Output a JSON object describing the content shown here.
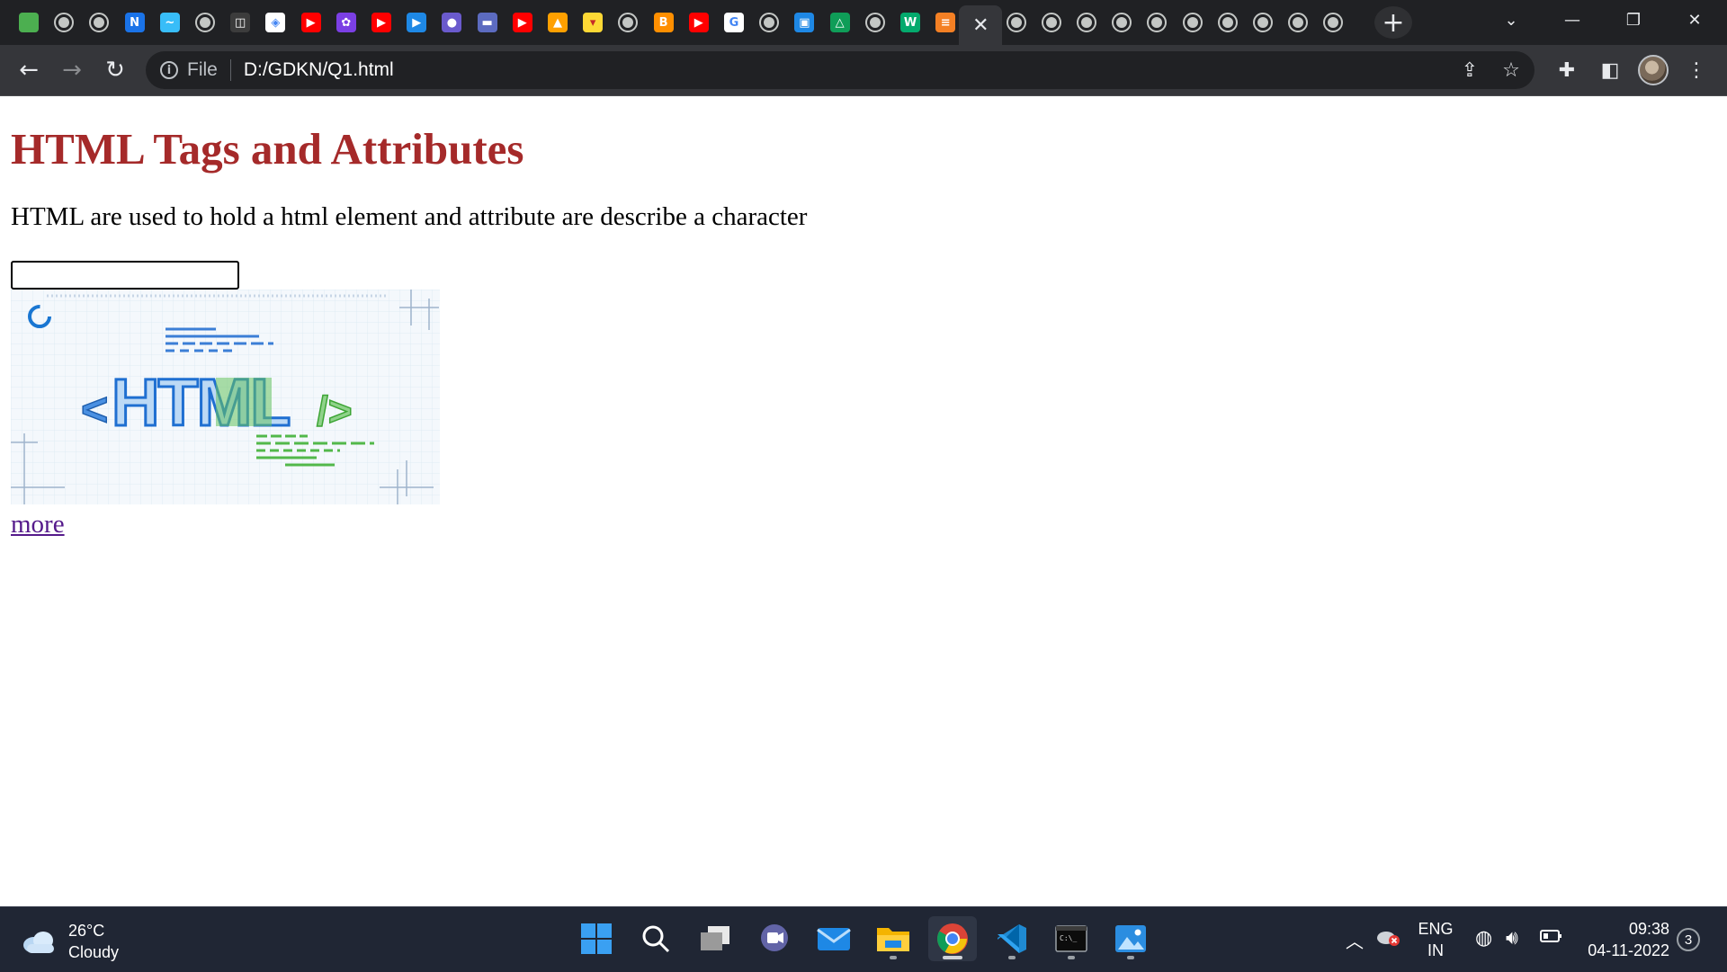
{
  "browser": {
    "url_scheme_label": "File",
    "url": "D:/GDKN/Q1.html",
    "tabs": [
      {
        "icon": "green-hexagon-favicon",
        "color": "#4caf50",
        "glyph": ""
      },
      {
        "icon": "globe-favicon",
        "color": "",
        "glyph": ""
      },
      {
        "icon": "globe-favicon",
        "color": "",
        "glyph": ""
      },
      {
        "icon": "notion-favicon",
        "color": "#1a73e8",
        "glyph": "N"
      },
      {
        "icon": "tailwind-favicon",
        "color": "#38bdf8",
        "glyph": "~"
      },
      {
        "icon": "globe-favicon",
        "color": "",
        "glyph": ""
      },
      {
        "icon": "book-favicon",
        "color": "#3c3c3c",
        "glyph": "◫"
      },
      {
        "icon": "diamond-favicon",
        "color": "#ffffff",
        "glyph": "◈"
      },
      {
        "icon": "youtube-favicon",
        "color": "#ff0000",
        "glyph": "▶"
      },
      {
        "icon": "graphql-favicon",
        "color": "#7b3fe4",
        "glyph": "✿"
      },
      {
        "icon": "youtube-favicon",
        "color": "#ff0000",
        "glyph": "▶"
      },
      {
        "icon": "play-favicon",
        "color": "#1e88e5",
        "glyph": "▶"
      },
      {
        "icon": "orb-favicon",
        "color": "#6a5acd",
        "glyph": "●"
      },
      {
        "icon": "window-favicon",
        "color": "#5c6bc0",
        "glyph": "▬"
      },
      {
        "icon": "youtube-favicon",
        "color": "#ff0000",
        "glyph": "▶"
      },
      {
        "icon": "firebase-favicon",
        "color": "#ffa000",
        "glyph": "▲"
      },
      {
        "icon": "cup-favicon",
        "color": "#fdd835",
        "glyph": "▾"
      },
      {
        "icon": "globe-favicon",
        "color": "",
        "glyph": ""
      },
      {
        "icon": "blogger-favicon",
        "color": "#ff8f00",
        "glyph": "B"
      },
      {
        "icon": "youtube-favicon",
        "color": "#ff0000",
        "glyph": "▶"
      },
      {
        "icon": "google-favicon",
        "color": "#ffffff",
        "glyph": "G"
      },
      {
        "icon": "globe-favicon",
        "color": "",
        "glyph": ""
      },
      {
        "icon": "classroom-favicon",
        "color": "#1e88e5",
        "glyph": "▣"
      },
      {
        "icon": "drive-favicon",
        "color": "#0f9d58",
        "glyph": "△"
      },
      {
        "icon": "globe-favicon",
        "color": "",
        "glyph": ""
      },
      {
        "icon": "w3schools-favicon",
        "color": "#04aa6d",
        "glyph": "W"
      },
      {
        "icon": "stackoverflow-favicon",
        "color": "#f48024",
        "glyph": "≡"
      },
      {
        "icon": "close-icon",
        "color": "",
        "glyph": "✕",
        "active": true
      },
      {
        "icon": "globe-favicon",
        "color": "",
        "glyph": ""
      },
      {
        "icon": "globe-favicon",
        "color": "",
        "glyph": ""
      },
      {
        "icon": "globe-favicon",
        "color": "",
        "glyph": ""
      },
      {
        "icon": "globe-favicon",
        "color": "",
        "glyph": ""
      },
      {
        "icon": "globe-favicon",
        "color": "",
        "glyph": ""
      },
      {
        "icon": "globe-favicon",
        "color": "",
        "glyph": ""
      },
      {
        "icon": "globe-favicon",
        "color": "",
        "glyph": ""
      },
      {
        "icon": "globe-favicon",
        "color": "",
        "glyph": ""
      },
      {
        "icon": "globe-favicon",
        "color": "",
        "glyph": ""
      },
      {
        "icon": "globe-favicon",
        "color": "",
        "glyph": ""
      }
    ]
  },
  "page": {
    "heading": "HTML Tags and Attributes",
    "paragraph": "HTML are used to hold a html element and attribute are describe a character",
    "input_value": "",
    "link_text": "more",
    "banner_text": "HTML",
    "heading_color": "#a52a2a",
    "link_color": "#551a8b"
  },
  "taskbar": {
    "weather_temp": "26°C",
    "weather_desc": "Cloudy",
    "apps": [
      {
        "name": "start-button",
        "icon": "windows-logo-icon",
        "running": false
      },
      {
        "name": "search-button",
        "icon": "search-icon",
        "running": false
      },
      {
        "name": "task-view-button",
        "icon": "task-view-icon",
        "running": false
      },
      {
        "name": "teams-chat-button",
        "icon": "teams-chat-icon",
        "running": false
      },
      {
        "name": "mail-app",
        "icon": "mail-icon",
        "running": false
      },
      {
        "name": "file-explorer-app",
        "icon": "folder-icon",
        "running": true
      },
      {
        "name": "chrome-app",
        "icon": "chrome-icon",
        "running": true,
        "active": true
      },
      {
        "name": "vscode-app",
        "icon": "vscode-icon",
        "running": true
      },
      {
        "name": "terminal-app",
        "icon": "terminal-icon",
        "running": true
      },
      {
        "name": "photos-app",
        "icon": "photos-icon",
        "running": true
      }
    ],
    "language_line1": "ENG",
    "language_line2": "IN",
    "time": "09:38",
    "date": "04-11-2022",
    "notification_count": "3"
  }
}
